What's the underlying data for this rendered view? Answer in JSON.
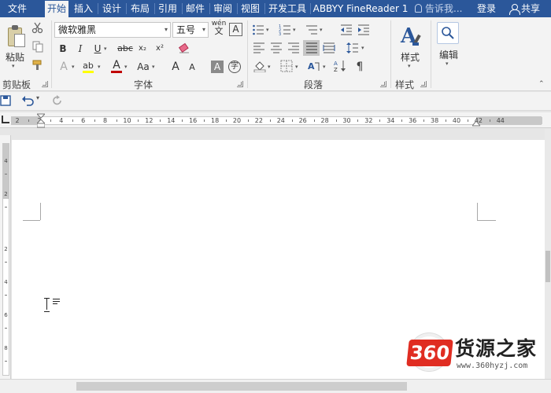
{
  "tabs": [
    "文件",
    "开始",
    "插入",
    "设计",
    "布局",
    "引用",
    "邮件",
    "审阅",
    "视图",
    "开发工具",
    "ABBYY FineReader 1"
  ],
  "active_tab": "开始",
  "tell_me_placeholder": "告诉我...",
  "login_label": "登录",
  "share_label": "共享",
  "clipboard": {
    "paste_label": "粘贴",
    "group_label": "剪贴板"
  },
  "font": {
    "name": "微软雅黑",
    "size": "五号",
    "wen_label": "wén",
    "bold": "B",
    "italic": "I",
    "underline": "U",
    "strike": "abc",
    "subscript": "x₂",
    "superscript": "x²",
    "grow": "A",
    "shrink": "A",
    "case": "Aa",
    "char_border": "A",
    "phonetic": "字",
    "group_label": "字体",
    "highlight_color": "#ffff00",
    "font_color": "#c00000"
  },
  "paragraph": {
    "group_label": "段落"
  },
  "styles": {
    "label": "样式",
    "group_label": "样式"
  },
  "editing": {
    "label": "编辑"
  },
  "ruler": {
    "numbers": [
      "2",
      "2",
      "4",
      "6",
      "8",
      "10",
      "12",
      "14",
      "16",
      "18",
      "20",
      "22",
      "24",
      "26",
      "28",
      "30",
      "32",
      "34",
      "36",
      "38",
      "40",
      "42",
      "44"
    ]
  },
  "vertical_ruler": {
    "numbers": [
      "4",
      "2",
      "2",
      "4",
      "6",
      "8"
    ]
  },
  "watermark": {
    "logo_text": "360",
    "title": "货源之家",
    "url": "www.360hyzj.com"
  },
  "colors": {
    "title_bar": "#2b579a",
    "ribbon": "#f3f3f3",
    "watermark_red": "#e02d22"
  }
}
